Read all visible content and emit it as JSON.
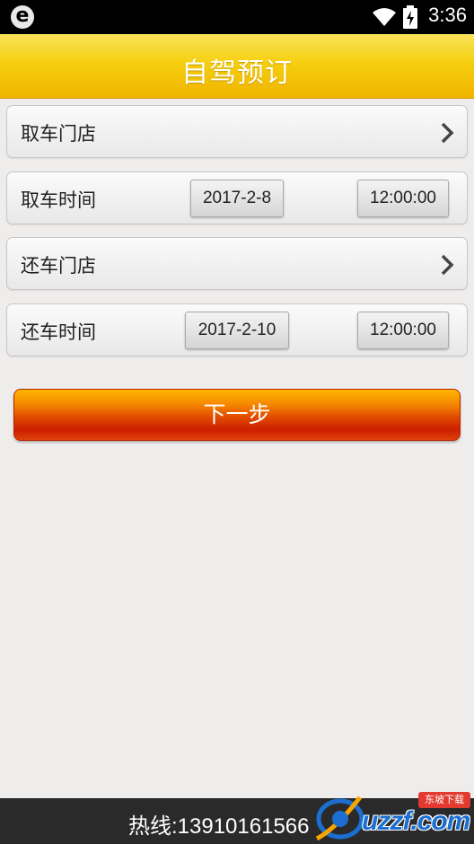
{
  "status_bar": {
    "time": "3:36",
    "app_icon": "e",
    "icons": [
      "wifi-icon",
      "battery-charging-icon"
    ]
  },
  "header": {
    "title": "自驾预订"
  },
  "rows": {
    "pickup_store": {
      "label": "取车门店"
    },
    "pickup_time": {
      "label": "取车时间",
      "date": "2017-2-8",
      "time": "12:00:00"
    },
    "return_store": {
      "label": "还车门店"
    },
    "return_time": {
      "label": "还车时间",
      "date": "2017-2-10",
      "time": "12:00:00"
    }
  },
  "next_button": {
    "label": "下一步"
  },
  "footer": {
    "hotline": "热线:13910161566"
  },
  "watermark": {
    "text": "uzzf.com",
    "subtext": "东坡下载"
  },
  "colors": {
    "header": "#f5cf0e",
    "button": "#cc1f00",
    "background": "#efecec",
    "footer": "#2a2a2a"
  }
}
